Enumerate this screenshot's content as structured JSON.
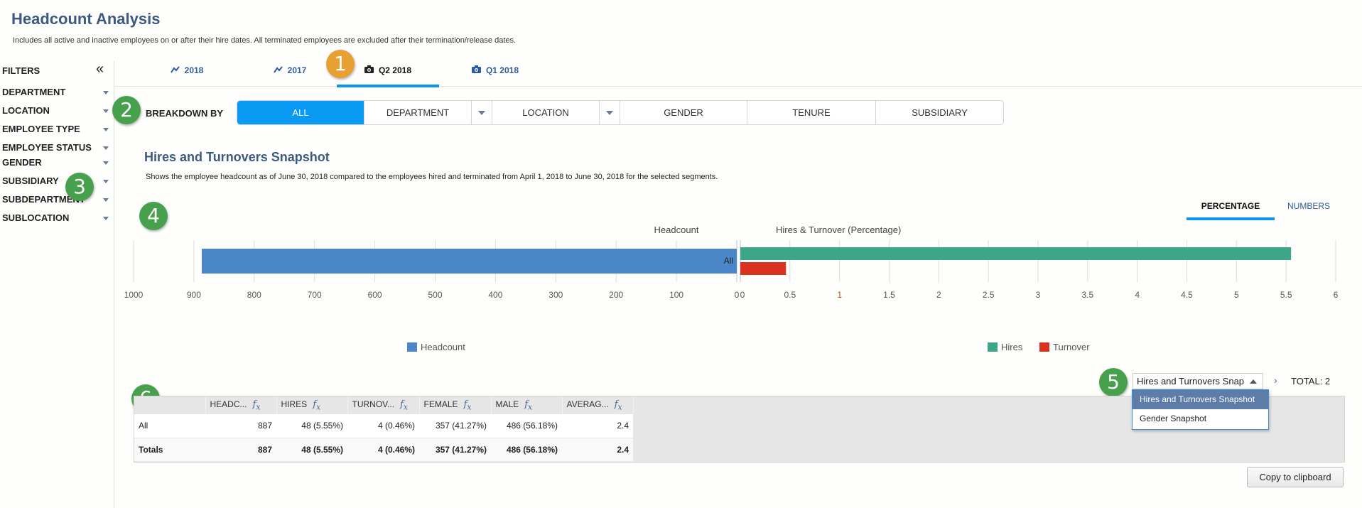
{
  "header": {
    "title": "Headcount Analysis",
    "subtitle": "Includes all active and inactive employees on or after their hire dates. All terminated employees are excluded after their termination/release dates."
  },
  "sidebar": {
    "heading": "FILTERS",
    "collapse_icon": "double-chevron-left",
    "collapse_glyph": "«",
    "items": [
      {
        "label": "DEPARTMENT"
      },
      {
        "label": "LOCATION"
      },
      {
        "label": "EMPLOYEE TYPE"
      },
      {
        "label": "EMPLOYEE STATUS"
      },
      {
        "label": "GENDER"
      },
      {
        "label": "SUBSIDIARY"
      },
      {
        "label": "SUBDEPARTMENT"
      },
      {
        "label": "SUBLOCATION"
      }
    ]
  },
  "tabs": [
    {
      "label": "2018",
      "icon": "trend-line-icon",
      "glyph": "〰",
      "active": false
    },
    {
      "label": "2017",
      "icon": "trend-line-icon",
      "glyph": "〰",
      "active": false
    },
    {
      "label": "Q2 2018",
      "icon": "camera-icon",
      "glyph": "📷",
      "active": true
    },
    {
      "label": "Q1 2018",
      "icon": "camera-icon",
      "glyph": "📷",
      "active": false
    }
  ],
  "annotations": [
    "1",
    "2",
    "3",
    "4",
    "5",
    "6"
  ],
  "breakdown": {
    "label": "BREAKDOWN BY",
    "options": [
      "ALL",
      "DEPARTMENT",
      "LOCATION",
      "GENDER",
      "TENURE",
      "SUBSIDIARY"
    ],
    "selected": "ALL"
  },
  "section": {
    "title": "Hires and Turnovers Snapshot",
    "description": "Shows the employee headcount as of June 30, 2018 compared to the employees hired and terminated from April 1, 2018 to June 30, 2018 for the selected segments."
  },
  "view_toggle": {
    "options": [
      "PERCENTAGE",
      "NUMBERS"
    ],
    "selected": "PERCENTAGE"
  },
  "chart_data": [
    {
      "type": "bar",
      "orientation": "horizontal",
      "title": "Headcount",
      "categories": [
        "All"
      ],
      "series": [
        {
          "name": "Headcount",
          "color": "#4a86c8",
          "values": [
            887
          ]
        }
      ],
      "xlim": [
        1000,
        0
      ],
      "xticks": [
        1000,
        900,
        800,
        700,
        600,
        500,
        400,
        300,
        200,
        100,
        0
      ],
      "grid": true,
      "legend": "bottom-left"
    },
    {
      "type": "bar",
      "orientation": "horizontal",
      "title": "Hires & Turnover (Percentage)",
      "categories": [
        "All"
      ],
      "series": [
        {
          "name": "Hires",
          "color": "#3ea688",
          "values": [
            5.55
          ]
        },
        {
          "name": "Turnover",
          "color": "#d93320",
          "values": [
            0.46
          ]
        }
      ],
      "xlim": [
        0,
        6
      ],
      "xticks": [
        0,
        0.5,
        1,
        1.5,
        2,
        2.5,
        3,
        3.5,
        4,
        4.5,
        5,
        5.5,
        6
      ],
      "grid": true,
      "legend": "bottom-right"
    }
  ],
  "table": {
    "columns": [
      "",
      "HEADC...",
      "HIRES",
      "TURNOV...",
      "FEMALE",
      "MALE",
      "AVERAG..."
    ],
    "formula_icon": "fx",
    "rows": [
      [
        "All",
        "887",
        "48 (5.55%)",
        "4 (0.46%)",
        "357 (41.27%)",
        "486 (56.18%)",
        "2.4"
      ],
      [
        "Totals",
        "887",
        "48 (5.55%)",
        "4 (0.46%)",
        "357 (41.27%)",
        "486 (56.18%)",
        "2.4"
      ]
    ]
  },
  "report_select": {
    "value": "Hires and Turnovers Snap",
    "options": [
      "Hires and Turnovers Snapshot",
      "Gender Snapshot"
    ],
    "selected": "Hires and Turnovers Snapshot",
    "next_glyph": "›",
    "total_label": "TOTAL: 2"
  },
  "copy_button": "Copy to clipboard"
}
